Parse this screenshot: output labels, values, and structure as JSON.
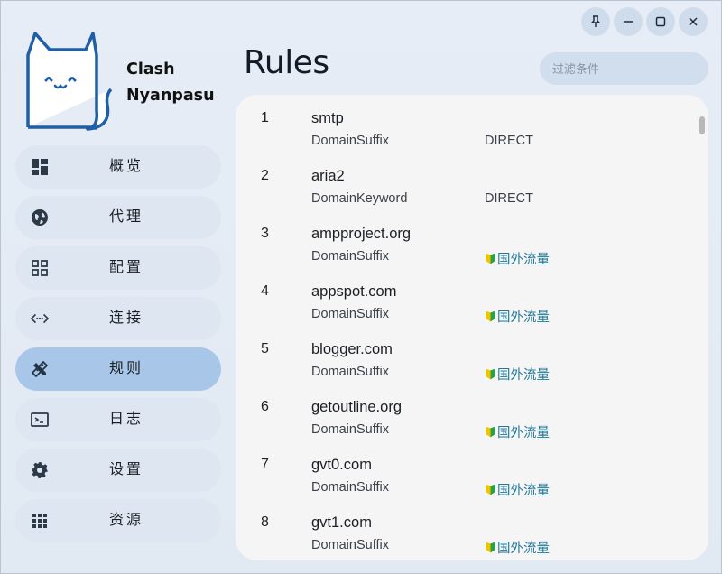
{
  "app": {
    "name_line1": "Clash",
    "name_line2": "Nyanpasu"
  },
  "window_controls": [
    {
      "name": "pin-icon"
    },
    {
      "name": "minimize-icon"
    },
    {
      "name": "maximize-icon"
    },
    {
      "name": "close-icon"
    }
  ],
  "nav": {
    "items": [
      {
        "label": "概览",
        "icon": "dashboard-icon",
        "active": false
      },
      {
        "label": "代理",
        "icon": "globe-icon",
        "active": false
      },
      {
        "label": "配置",
        "icon": "grid-icon",
        "active": false
      },
      {
        "label": "连接",
        "icon": "connections-icon",
        "active": false
      },
      {
        "label": "规则",
        "icon": "ruler-pencil-icon",
        "active": true
      },
      {
        "label": "日志",
        "icon": "terminal-icon",
        "active": false
      },
      {
        "label": "设置",
        "icon": "gear-icon",
        "active": false
      },
      {
        "label": "资源",
        "icon": "apps-icon",
        "active": false
      }
    ]
  },
  "main": {
    "title": "Rules",
    "filter_placeholder": "过滤条件"
  },
  "rules": [
    {
      "index": "1",
      "payload": "smtp",
      "type": "DomainSuffix",
      "proxy": "DIRECT",
      "flag": false
    },
    {
      "index": "2",
      "payload": "aria2",
      "type": "DomainKeyword",
      "proxy": "DIRECT",
      "flag": false
    },
    {
      "index": "3",
      "payload": "ampproject.org",
      "type": "DomainSuffix",
      "proxy": "国外流量",
      "flag": true
    },
    {
      "index": "4",
      "payload": "appspot.com",
      "type": "DomainSuffix",
      "proxy": "国外流量",
      "flag": true
    },
    {
      "index": "5",
      "payload": "blogger.com",
      "type": "DomainSuffix",
      "proxy": "国外流量",
      "flag": true
    },
    {
      "index": "6",
      "payload": "getoutline.org",
      "type": "DomainSuffix",
      "proxy": "国外流量",
      "flag": true
    },
    {
      "index": "7",
      "payload": "gvt0.com",
      "type": "DomainSuffix",
      "proxy": "国外流量",
      "flag": true
    },
    {
      "index": "8",
      "payload": "gvt1.com",
      "type": "DomainSuffix",
      "proxy": "国外流量",
      "flag": true
    }
  ],
  "colors": {
    "accent": "#a8c7e8",
    "proxy_link": "#1f7a99",
    "logo": "#1f5fa8"
  }
}
